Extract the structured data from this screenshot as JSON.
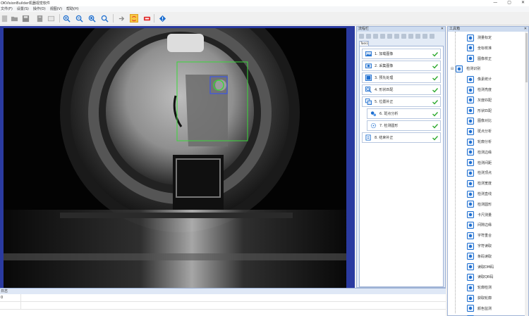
{
  "window": {
    "title": "OKVisionBuilder机器视觉软件",
    "controls": [
      "—",
      "▢",
      "✕"
    ]
  },
  "menu": [
    "文件(F)",
    "设置(S)",
    "操作(O)",
    "视图(V)",
    "帮助(H)"
  ],
  "toolbar": {
    "icons": [
      "new-icon",
      "open-icon",
      "save-icon",
      "print-icon",
      "image-icon",
      "zoom-in-icon",
      "zoom-out-icon",
      "zoom-fit-icon",
      "zoom-actual-icon",
      "run-once-icon",
      "run-loop-icon",
      "stop-icon",
      "info-icon"
    ]
  },
  "flow_panel": {
    "title": "流程栏",
    "close": "✕",
    "tab": "Task1",
    "items": [
      {
        "label": "1. 加载图像",
        "indent": 0,
        "icon": "image-load-icon",
        "ok": true
      },
      {
        "label": "2. 采集图像",
        "indent": 0,
        "icon": "camera-icon",
        "ok": true
      },
      {
        "label": "3. 预先处理",
        "indent": 0,
        "icon": "preprocess-icon",
        "ok": true
      },
      {
        "label": "4. 形状匹配",
        "indent": 0,
        "icon": "shape-match-icon",
        "ok": true
      },
      {
        "label": "5. 位置补正",
        "indent": 0,
        "icon": "position-correct-icon",
        "ok": true
      },
      {
        "label": "6. 斑点分析",
        "indent": 1,
        "icon": "blob-icon",
        "ok": true
      },
      {
        "label": "7. 检测圆形",
        "indent": 1,
        "icon": "circle-detect-icon",
        "ok": true
      },
      {
        "label": "8. 结束补正",
        "indent": 0,
        "icon": "end-correct-icon",
        "ok": true
      }
    ]
  },
  "toolbox": {
    "title": "工具箱",
    "close": "✕",
    "items": [
      {
        "label": "测量标定",
        "group": false,
        "icon": "calibrate-icon"
      },
      {
        "label": "坐标校准",
        "group": false,
        "icon": "coord-icon"
      },
      {
        "label": "图像校正",
        "group": false,
        "icon": "image-correct-icon"
      },
      {
        "label": "检测识别",
        "group": true,
        "icon": "detect-group-icon"
      },
      {
        "label": "像素统计",
        "group": false,
        "icon": "pixel-stat-icon"
      },
      {
        "label": "检测亮度",
        "group": false,
        "icon": "brightness-icon"
      },
      {
        "label": "灰度匹配",
        "group": false,
        "icon": "gray-match-icon"
      },
      {
        "label": "形状匹配",
        "group": false,
        "icon": "shape-match-icon"
      },
      {
        "label": "图像对比",
        "group": false,
        "icon": "image-compare-icon"
      },
      {
        "label": "斑点分析",
        "group": false,
        "icon": "blob-icon"
      },
      {
        "label": "轮廓分析",
        "group": false,
        "icon": "contour-icon"
      },
      {
        "label": "检测边缘",
        "group": false,
        "icon": "edge-icon"
      },
      {
        "label": "检测间距",
        "group": false,
        "icon": "distance-icon"
      },
      {
        "label": "检测顶点",
        "group": false,
        "icon": "vertex-icon"
      },
      {
        "label": "检测宽度",
        "group": false,
        "icon": "width-icon"
      },
      {
        "label": "检测直线",
        "group": false,
        "icon": "line-icon"
      },
      {
        "label": "检测圆形",
        "group": false,
        "icon": "circle-detect-icon"
      },
      {
        "label": "卡尺测量",
        "group": false,
        "icon": "caliper-icon"
      },
      {
        "label": "间隙边缘",
        "group": false,
        "icon": "gap-icon"
      },
      {
        "label": "字符重合",
        "group": false,
        "icon": "char-overlap-icon"
      },
      {
        "label": "字符读取",
        "group": false,
        "icon": "ocr-icon"
      },
      {
        "label": "条码读取",
        "group": false,
        "icon": "barcode-icon"
      },
      {
        "label": "读取DM码",
        "group": false,
        "icon": "dm-code-icon"
      },
      {
        "label": "读取QR码",
        "group": false,
        "icon": "qr-code-icon"
      },
      {
        "label": "轮廓检测",
        "group": false,
        "icon": "contour-detect-icon"
      },
      {
        "label": "获取轮廓",
        "group": false,
        "icon": "get-contour-icon"
      },
      {
        "label": "颜色监测",
        "group": false,
        "icon": "color-monitor-icon"
      },
      {
        "label": "颜色识别",
        "group": false,
        "icon": "color-id-icon"
      }
    ]
  },
  "log_panel": {
    "title": "日志",
    "row1": "0"
  },
  "colors": {
    "accent_blue": "#1e6fd0",
    "check_green": "#2eaa2e",
    "roi_green": "#3ad83a",
    "viewer_frame": "#2a3aa0"
  }
}
